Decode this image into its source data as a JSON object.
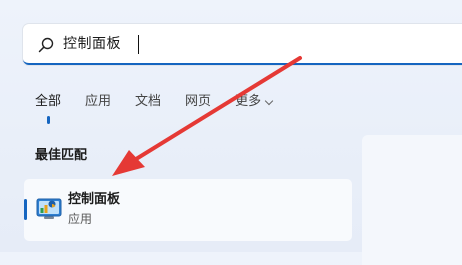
{
  "search": {
    "query": "控制面板"
  },
  "tabs": [
    {
      "label": "全部",
      "active": true
    },
    {
      "label": "应用",
      "active": false
    },
    {
      "label": "文档",
      "active": false
    },
    {
      "label": "网页",
      "active": false
    },
    {
      "label": "更多",
      "active": false
    }
  ],
  "best_match": {
    "heading": "最佳匹配",
    "result": {
      "title": "控制面板",
      "subtitle": "应用",
      "icon": "control-panel-icon"
    }
  },
  "colors": {
    "accent": "#1565c0",
    "annotation_arrow": "#e53935"
  }
}
